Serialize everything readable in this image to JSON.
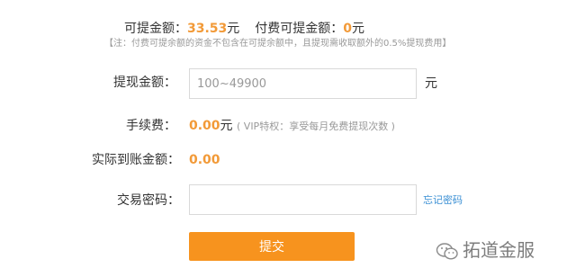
{
  "balance": {
    "withdrawable_label": "可提金额：",
    "withdrawable_value": "33.53",
    "withdrawable_unit": "元",
    "paid_label": "付费可提金额：",
    "paid_value": "0",
    "paid_unit": "元",
    "note": "【注：付费可提余额的资金不包含在可提余额中，且提现需收取额外的0.5%提现费用】"
  },
  "withdraw": {
    "label": "提现金额：",
    "placeholder": "100~49900",
    "unit": "元"
  },
  "fee": {
    "label": "手续费：",
    "value": "0.00",
    "unit": "元",
    "note": "( VIP特权：享受每月免费提现次数 )"
  },
  "actual": {
    "label": "实际到账金额：",
    "value": "0.00"
  },
  "password": {
    "label": "交易密码：",
    "value": "",
    "forgot_label": "忘记密码"
  },
  "submit_label": "提交",
  "watermark": {
    "text": "拓道金服",
    "icon": "wechat-icon"
  },
  "colors": {
    "accent": "#f7931e",
    "value_orange": "#f29a38",
    "link": "#3a8fd4",
    "muted": "#999999"
  }
}
